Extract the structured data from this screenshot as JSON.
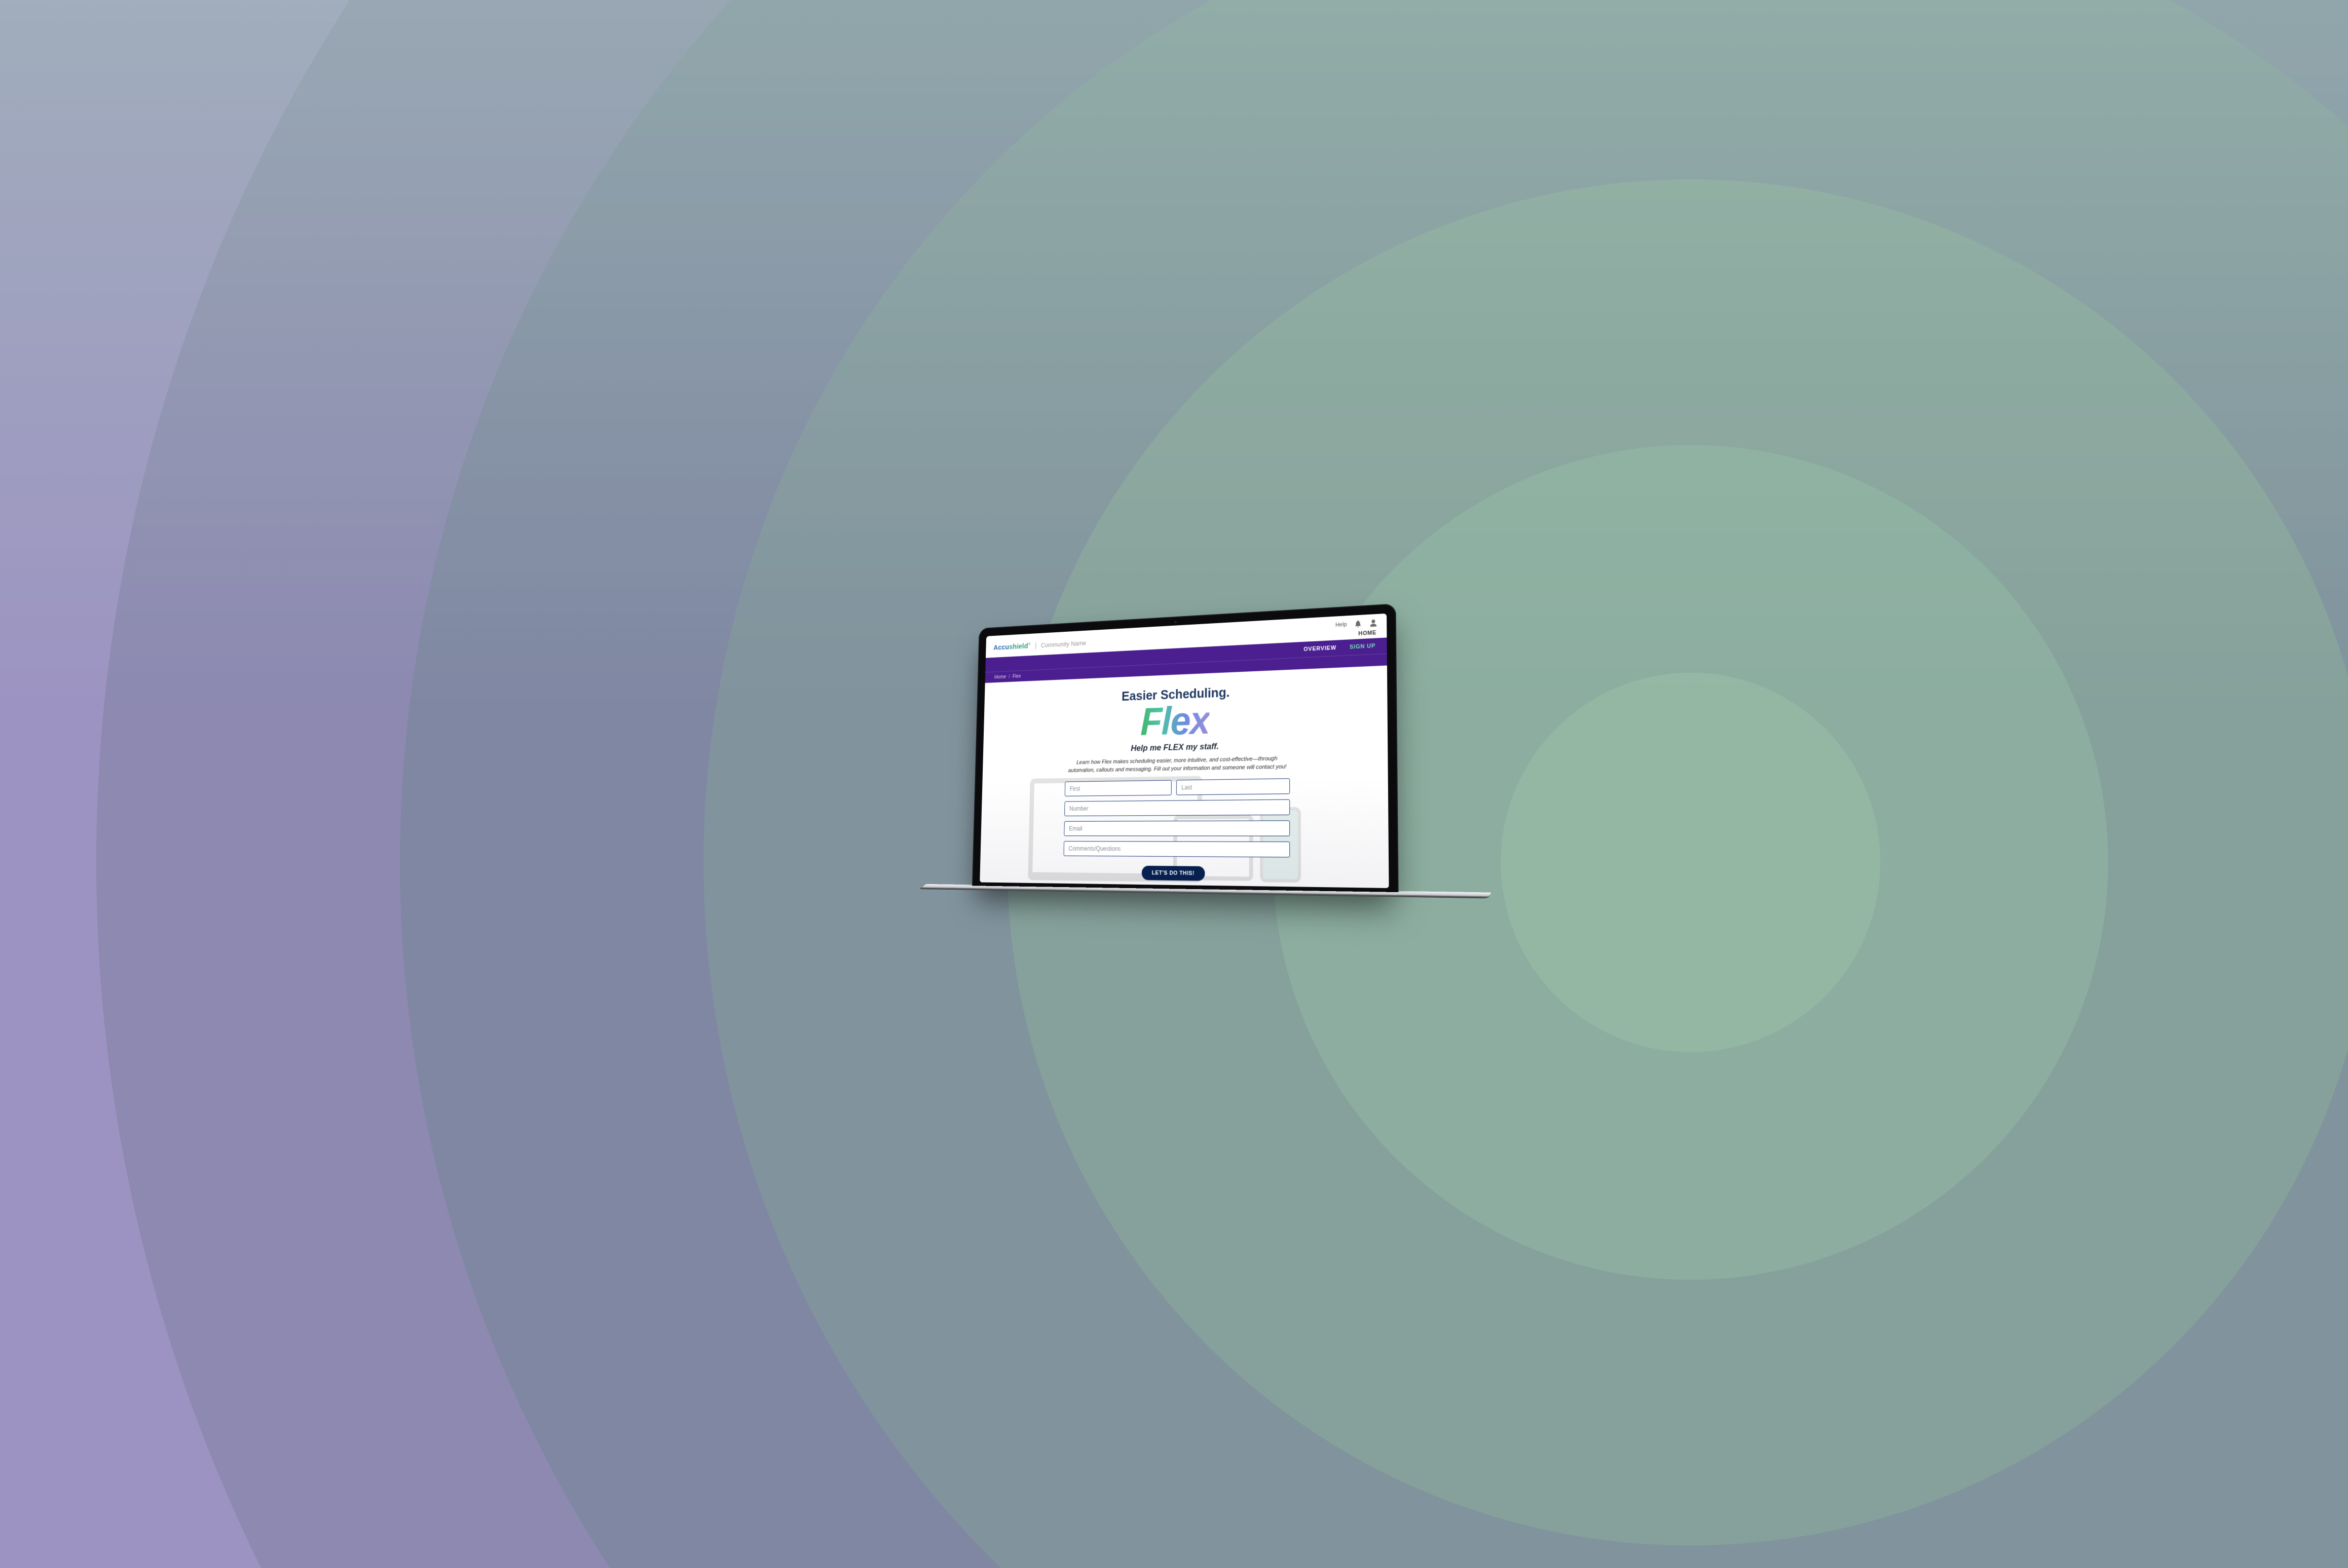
{
  "brand": {
    "name_part1": "Accu",
    "name_part2": "shield",
    "trademark": "®",
    "separator": "|",
    "community_label": "Community Name"
  },
  "top_nav": {
    "help_label": "Help",
    "home_label": "HOME"
  },
  "purple_nav": {
    "overview": "OVERVIEW",
    "signup": "SIGN UP"
  },
  "breadcrumb": {
    "home": "Home",
    "separator": "/",
    "current": "Flex"
  },
  "hero": {
    "headline1": "Easier Scheduling.",
    "flex_word": "Flex",
    "headline2": "Help me FLEX my staff.",
    "blurb": "Learn how Flex makes scheduling easier, more intuitive, and cost-effective—through automation, callouts and messaging. Fill out your information and someone will contact you!"
  },
  "form": {
    "first_placeholder": "First",
    "last_placeholder": "Last",
    "number_placeholder": "Number",
    "email_placeholder": "Email",
    "comments_placeholder": "Comments/Questions",
    "submit_label": "LET'S DO THIS!"
  },
  "colors": {
    "primary_purple": "#4b1f8f",
    "accent_teal": "#2f9f86",
    "submit_navy": "#07204f"
  }
}
